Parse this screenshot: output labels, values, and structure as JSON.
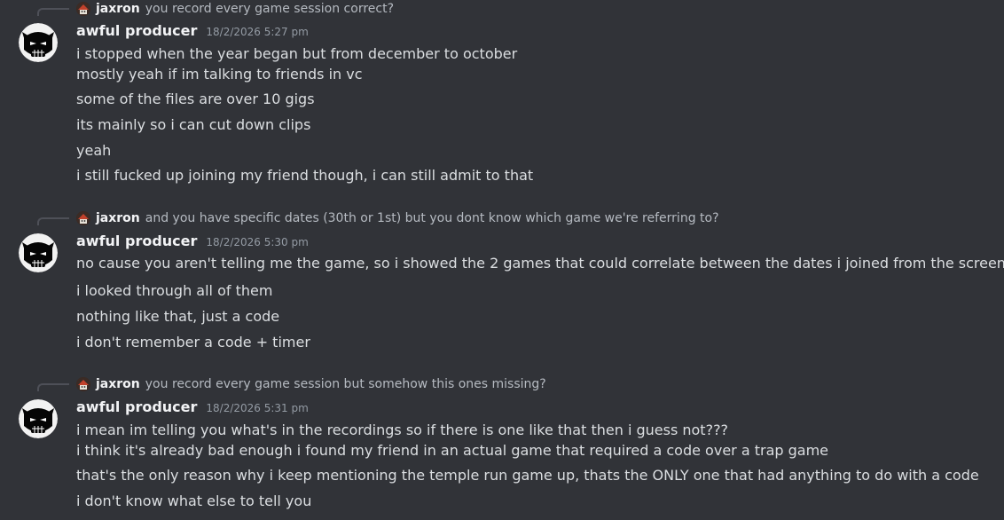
{
  "groups": [
    {
      "reply": {
        "author": "jaxron",
        "text": "you record every game session correct?"
      },
      "author": "awful producer",
      "timestamp": "18/2/2026 5:27 pm",
      "lines": [
        "i stopped when the year began but from december to october",
        "mostly yeah if im talking to friends in vc",
        "some of the files are over 10 gigs",
        "its mainly so i can cut down clips",
        "yeah",
        "i still fucked up joining my friend though, i can still admit to that"
      ]
    },
    {
      "reply": {
        "author": "jaxron",
        "text": "and you have specific dates (30th or 1st) but you dont know which game we're referring to?"
      },
      "author": "awful producer",
      "timestamp": "18/2/2026 5:30 pm",
      "lines": [
        "no cause you aren't telling me the game, so i showed the 2 games that could correlate between the dates i joined from the screenshot",
        "i looked through all of them",
        "nothing like that, just a code",
        "i don't remember a code + timer"
      ]
    },
    {
      "reply": {
        "author": "jaxron",
        "text": "you record every game session but somehow this ones missing?"
      },
      "author": "awful producer",
      "timestamp": "18/2/2026 5:31 pm",
      "lines": [
        "i mean im telling you what's in the recordings so if there is one like that then i guess not???",
        "i think it's already bad enough i found my friend in an actual game that required a code over a trap game",
        "that's the only reason why i keep mentioning the temple run game up, thats the ONLY one that had anything to do with a code",
        "i don't know what else to tell you"
      ]
    }
  ],
  "icons": {
    "reply_avatar": "jaxron-mini-avatar",
    "user_avatar": "awful-producer-avatar"
  }
}
